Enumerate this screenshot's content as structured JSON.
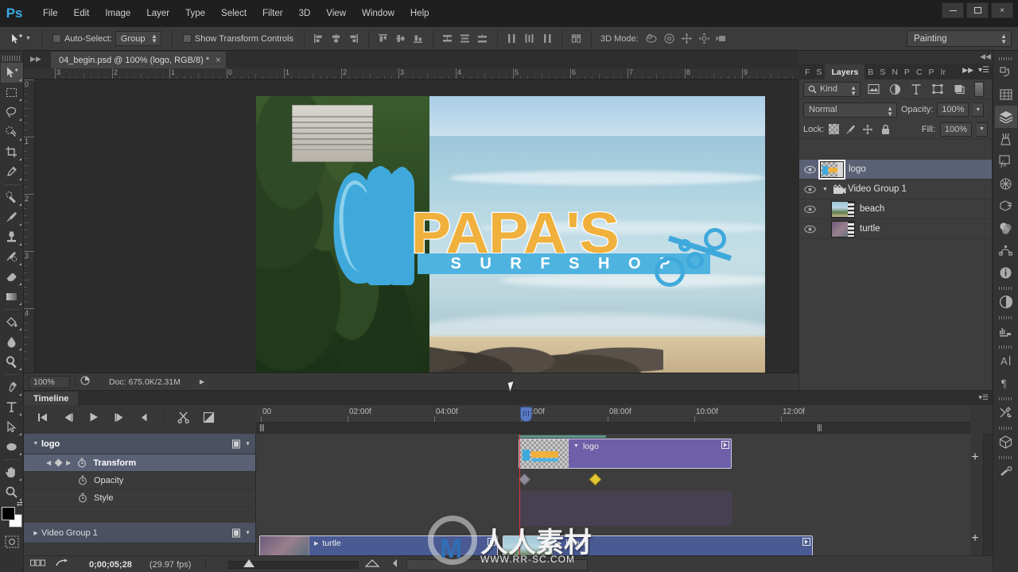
{
  "app": {
    "logo": "Ps",
    "menus": [
      "File",
      "Edit",
      "Image",
      "Layer",
      "Type",
      "Select",
      "Filter",
      "3D",
      "View",
      "Window",
      "Help"
    ],
    "window_buttons": {
      "minimize": "minimize-icon",
      "maximize": "maximize-icon",
      "close": "×"
    }
  },
  "options_bar": {
    "tool_icon": "move-tool-icon",
    "auto_select_label": "Auto-Select:",
    "auto_select_value": "Group",
    "auto_select_checked": false,
    "show_transform_label": "Show Transform Controls",
    "show_transform_checked": false,
    "mode_3d_label": "3D Mode:",
    "workspace": "Painting",
    "align_icons": [
      "align-left-edges-icon",
      "align-horizontal-centers-icon",
      "align-right-edges-icon",
      "align-top-edges-icon",
      "align-vertical-centers-icon",
      "align-bottom-edges-icon"
    ],
    "distribute_icons": [
      "distribute-top-edges-icon",
      "distribute-vertical-centers-icon",
      "distribute-bottom-edges-icon",
      "distribute-left-edges-icon",
      "distribute-horizontal-centers-icon",
      "distribute-right-edges-icon",
      "auto-align-layers-icon"
    ],
    "mode_3d_icons": [
      "orbit-3d-icon",
      "roll-3d-icon",
      "pan-3d-icon",
      "slide-3d-icon",
      "camera-3d-icon"
    ]
  },
  "toolbar": {
    "tools": [
      {
        "name": "move-tool",
        "active": true
      },
      {
        "name": "rectangular-marquee-tool",
        "active": false
      },
      {
        "name": "lasso-tool",
        "active": false
      },
      {
        "name": "quick-selection-tool",
        "active": false
      },
      {
        "name": "crop-tool",
        "active": false
      },
      {
        "name": "eyedropper-tool",
        "active": false
      },
      {
        "name": "spot-healing-brush-tool",
        "active": false
      },
      {
        "name": "brush-tool",
        "active": false
      },
      {
        "name": "clone-stamp-tool",
        "active": false
      },
      {
        "name": "history-brush-tool",
        "active": false
      },
      {
        "name": "eraser-tool",
        "active": false
      },
      {
        "name": "gradient-tool",
        "active": false
      },
      {
        "name": "blur-tool",
        "active": false
      },
      {
        "name": "dodge-tool",
        "active": false
      },
      {
        "name": "pen-tool",
        "active": false
      },
      {
        "name": "horizontal-type-tool",
        "active": false
      },
      {
        "name": "path-selection-tool",
        "active": false
      },
      {
        "name": "ellipse-tool",
        "active": false
      },
      {
        "name": "hand-tool",
        "active": false
      },
      {
        "name": "zoom-tool",
        "active": false
      }
    ],
    "foreground_color": "#000000",
    "background_color": "#ffffff"
  },
  "document": {
    "tab_title": "04_begin.psd @ 100% (logo, RGB/8) *",
    "close_glyph": "×",
    "ruler_h_labels": [
      "3",
      "2",
      "1",
      "0",
      "1",
      "2",
      "3",
      "4",
      "5",
      "6",
      "7",
      "8",
      "9"
    ],
    "ruler_v_labels": [
      "0",
      "1",
      "2",
      "3",
      "4"
    ]
  },
  "artwork": {
    "logo_title": "PAPA'S",
    "logo_subtitle": "S U R F   S H O P"
  },
  "status_bar": {
    "zoom": "100%",
    "doc_info": "Doc: 675.0K/2.31M",
    "arrow_glyph": "▶"
  },
  "layers_panel": {
    "tab_group": [
      "F",
      "S",
      "Layers",
      "B",
      "S",
      "N",
      "P",
      "C",
      "P",
      "Ir"
    ],
    "active_tab": "Layers",
    "filter_label": "Kind",
    "filter_icons": [
      "filter-pixel-icon",
      "filter-adjustment-icon",
      "filter-type-icon",
      "filter-shape-icon",
      "filter-smartobject-icon"
    ],
    "blend_mode": "Normal",
    "opacity_label": "Opacity:",
    "opacity_value": "100%",
    "lock_label": "Lock:",
    "lock_icons": [
      "lock-transparent-pixels-icon",
      "lock-image-pixels-icon",
      "lock-position-icon",
      "lock-all-icon"
    ],
    "fill_label": "Fill:",
    "fill_value": "100%",
    "layers": [
      {
        "name": "logo",
        "visible": true,
        "selected": true,
        "indent": 0,
        "kind": "smart-object",
        "expandable": false
      },
      {
        "name": "Video Group 1",
        "visible": true,
        "selected": false,
        "indent": 0,
        "kind": "video-group",
        "expandable": true,
        "expanded": true
      },
      {
        "name": "beach",
        "visible": true,
        "selected": false,
        "indent": 1,
        "kind": "video",
        "expandable": false
      },
      {
        "name": "turtle",
        "visible": true,
        "selected": false,
        "indent": 1,
        "kind": "video",
        "expandable": false
      }
    ],
    "footer_icons": [
      "link-layers-icon",
      "add-layer-style-icon",
      "add-layer-mask-icon",
      "new-adjustment-layer-icon",
      "new-group-icon",
      "new-layer-icon",
      "delete-layer-icon"
    ]
  },
  "right_rail": {
    "items": [
      {
        "name": "history-panel-icon",
        "active": false
      },
      {
        "name": "mini-bridge-panel-icon",
        "active": false
      },
      {
        "name": "layers-panel-icon",
        "active": true
      },
      {
        "name": "brush-panel-icon",
        "active": false
      },
      {
        "name": "layer-styles-panel-icon",
        "active": false
      },
      {
        "name": "3d-panel-icon",
        "active": false
      },
      {
        "name": "properties-panel-icon",
        "active": false
      },
      {
        "name": "color-panel-icon",
        "active": false
      },
      {
        "name": "paths-panel-icon",
        "active": false
      },
      {
        "name": "info-panel-icon",
        "active": false
      },
      {
        "name": "adjustments-panel-icon",
        "active": false
      },
      {
        "name": "histogram-panel-icon",
        "active": false
      },
      {
        "name": "character-panel-icon",
        "active": false
      },
      {
        "name": "paragraph-panel-icon",
        "active": false
      },
      {
        "name": "tool-presets-panel-icon",
        "active": false
      },
      {
        "name": "3d-scene-panel-icon",
        "active": false
      },
      {
        "name": "measurement-panel-icon",
        "active": false
      }
    ]
  },
  "timeline": {
    "tab_label": "Timeline",
    "transport": [
      {
        "name": "go-to-first-frame-button",
        "glyph": "first"
      },
      {
        "name": "previous-frame-button",
        "glyph": "prev"
      },
      {
        "name": "play-button",
        "glyph": "play"
      },
      {
        "name": "next-frame-button",
        "glyph": "next"
      },
      {
        "name": "audio-mute-button",
        "glyph": "audio"
      }
    ],
    "tools": [
      {
        "name": "split-at-playhead-button",
        "glyph": "scissors"
      },
      {
        "name": "transition-button",
        "glyph": "transition"
      }
    ],
    "ruler_labels": [
      "00",
      "02:00f",
      "04:00f",
      "06:00f",
      "08:00f",
      "10:00f",
      "12:00f"
    ],
    "tracks": [
      {
        "name": "logo",
        "type": "header",
        "expanded": true,
        "selected": false
      },
      {
        "name": "Transform",
        "type": "property",
        "selected": true,
        "has_keyframe_nav": true
      },
      {
        "name": "Opacity",
        "type": "property",
        "selected": false,
        "has_keyframe_nav": false
      },
      {
        "name": "Style",
        "type": "property",
        "selected": false,
        "has_keyframe_nav": false
      },
      {
        "name": "Video Group 1",
        "type": "header",
        "expanded": false,
        "selected": false
      }
    ],
    "clips": [
      {
        "name": "logo",
        "color": "purple",
        "track": "logo"
      },
      {
        "name": "turtle",
        "color": "blue",
        "track": "Video Group 1"
      },
      {
        "name": "beach",
        "color": "blue",
        "track": "Video Group 1"
      }
    ],
    "keyframes": [
      {
        "time": "0;00;05;28",
        "color": "gray",
        "selected": false
      },
      {
        "time": "0;00;08;00",
        "color": "gold",
        "selected": true
      }
    ],
    "playhead_time": "0;00;05;28",
    "current_time": "0;00;05;28",
    "frame_rate": "(29.97 fps)",
    "add_media_glyph": "+"
  },
  "watermark": {
    "text": "人人素材",
    "url": "WWW.RR-SC.COM",
    "mark": "M"
  },
  "colors": {
    "accent_blue": "#3fa9dc",
    "logo_yellow": "#f0b03c",
    "clip_purple": "#6f5fa8",
    "clip_blue": "#4a5a93",
    "selection": "#5a6175",
    "playhead_red": "#dd3333",
    "keyframe_gold": "#e8c832"
  }
}
